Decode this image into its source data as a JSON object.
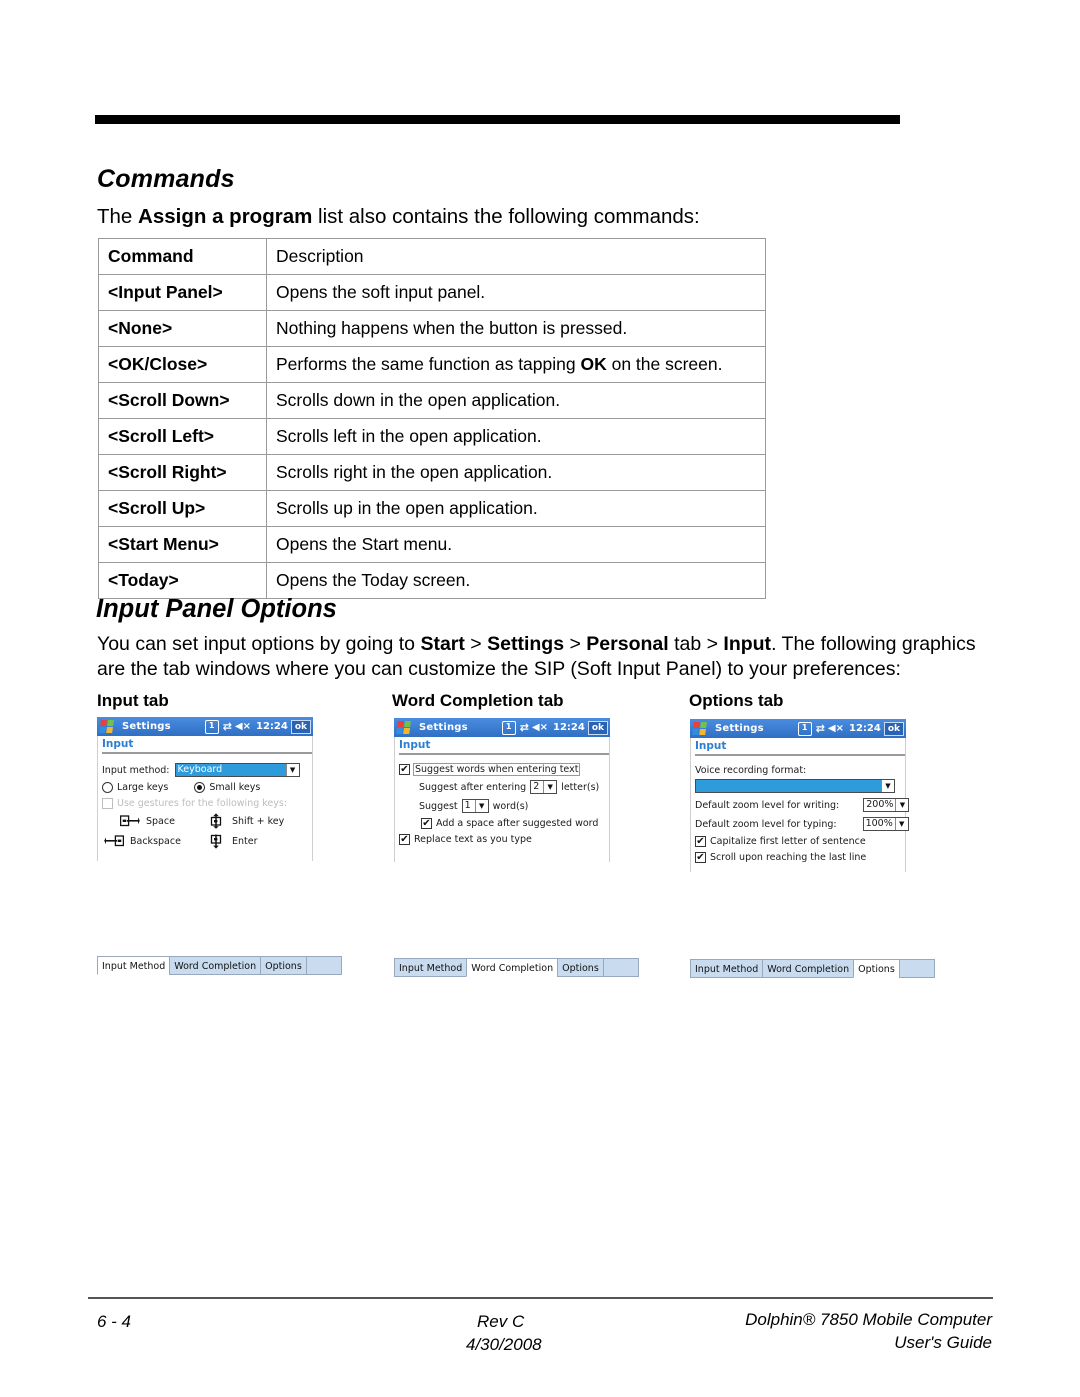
{
  "header": {
    "rule": true
  },
  "commands_section": {
    "heading": "Commands",
    "intro_prefix": "The ",
    "intro_bold": "Assign a program",
    "intro_suffix": " list also contains the following commands:",
    "table": {
      "columns": [
        "Command",
        "Description"
      ],
      "rows": [
        {
          "command": "<Input Panel>",
          "description": "Opens the soft input panel."
        },
        {
          "command": "<None>",
          "description": "Nothing happens when the button is pressed."
        },
        {
          "command": "<OK/Close>",
          "description_pre": "Performs the same function as tapping ",
          "description_bold": "OK",
          "description_post": " on the screen."
        },
        {
          "command": "<Scroll Down>",
          "description": "Scrolls down in the open application."
        },
        {
          "command": "<Scroll Left>",
          "description": "Scrolls left in the open application."
        },
        {
          "command": "<Scroll Right>",
          "description": "Scrolls right in the open application."
        },
        {
          "command": "<Scroll Up>",
          "description": "Scrolls up in the open application."
        },
        {
          "command": "<Start Menu>",
          "description": "Opens the Start menu."
        },
        {
          "command": "<Today>",
          "description": "Opens the Today screen."
        }
      ]
    }
  },
  "input_panel_options": {
    "heading": "Input Panel Options",
    "para_1": "You can set input options by going to ",
    "para_b1": "Start",
    "para_2": " > ",
    "para_b2": "Settings",
    "para_3": " > ",
    "para_b3": "Personal",
    "para_4": " tab > ",
    "para_b4": "Input",
    "para_5": ". The following graphics are the tab windows where you can customize the SIP (Soft Input Panel) to your preferences:",
    "captions": [
      "Input tab",
      "Word Completion tab",
      "Options tab"
    ]
  },
  "titlebar": {
    "app": "Settings",
    "time": "12:24",
    "ok_label": "ok",
    "icons": [
      "windows-flag-icon",
      "clock-icon",
      "network-icon",
      "speaker-mute-icon"
    ],
    "accent_color": "#3b7dd8"
  },
  "subtitle": {
    "label": "Input",
    "color": "#2a7fd0"
  },
  "screens": {
    "input_tab": {
      "input_method_label": "Input method:",
      "input_method_value": "Keyboard",
      "key_size": [
        {
          "label": "Large keys",
          "selected": false
        },
        {
          "label": "Small keys",
          "selected": true
        }
      ],
      "gestures_checkbox": {
        "label": "Use gestures for the following keys:",
        "checked": false,
        "disabled": true
      },
      "gestures": [
        {
          "icon": "gesture-space-icon",
          "glyph": "□→",
          "label": "Space"
        },
        {
          "icon": "gesture-shift-icon",
          "glyph": "↕",
          "label": "Shift + key"
        },
        {
          "icon": "gesture-backspace-icon",
          "glyph": "←□",
          "label": "Backspace"
        },
        {
          "icon": "gesture-enter-icon",
          "glyph": "↓",
          "label": "Enter"
        }
      ]
    },
    "word_completion_tab": {
      "suggest_words": {
        "label": "Suggest words when entering text",
        "checked": true,
        "focused": true
      },
      "suggest_after_pre": "Suggest after entering",
      "suggest_after_value": "2",
      "suggest_after_post": "letter(s)",
      "suggest_count_pre": "Suggest",
      "suggest_count_value": "1",
      "suggest_count_post": "word(s)",
      "add_space": {
        "label": "Add a space after suggested word",
        "checked": true
      },
      "replace_text": {
        "label": "Replace text as you type",
        "checked": true
      }
    },
    "options_tab": {
      "voice_format_label": "Voice recording format:",
      "voice_format_value": "",
      "zoom_writing_label": "Default zoom level for writing:",
      "zoom_writing_value": "200%",
      "zoom_typing_label": "Default zoom level for typing:",
      "zoom_typing_value": "100%",
      "capitalize": {
        "label": "Capitalize first letter of sentence",
        "checked": true
      },
      "scroll_last_line": {
        "label": "Scroll upon reaching the last line",
        "checked": true
      }
    }
  },
  "tab_strips": {
    "labels": [
      "Input Method",
      "Word Completion",
      "Options"
    ],
    "active": [
      "Input Method",
      "Word Completion",
      "Options"
    ]
  },
  "footer": {
    "page_number": "6 - 4",
    "revision": "Rev C",
    "date": "4/30/2008",
    "product": "Dolphin® 7850 Mobile Computer",
    "guide": "User's Guide"
  }
}
